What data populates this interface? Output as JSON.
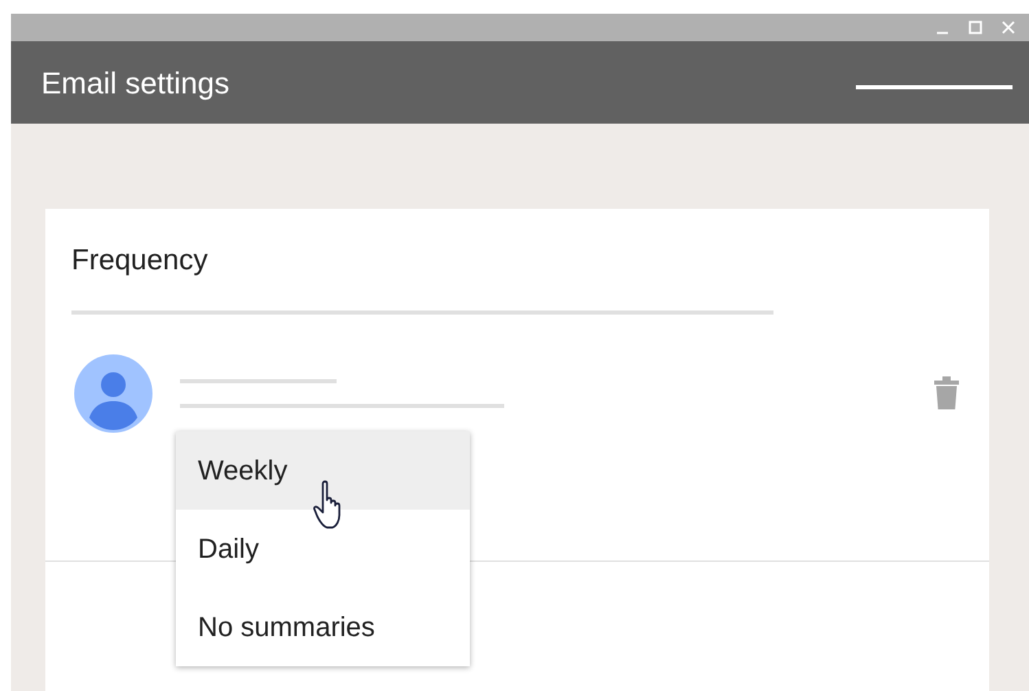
{
  "window": {
    "title": "Email settings"
  },
  "card": {
    "heading": "Frequency"
  },
  "menu": {
    "items": [
      {
        "label": "Weekly",
        "selected": true
      },
      {
        "label": "Daily",
        "selected": false
      },
      {
        "label": "No summaries",
        "selected": false
      }
    ]
  }
}
